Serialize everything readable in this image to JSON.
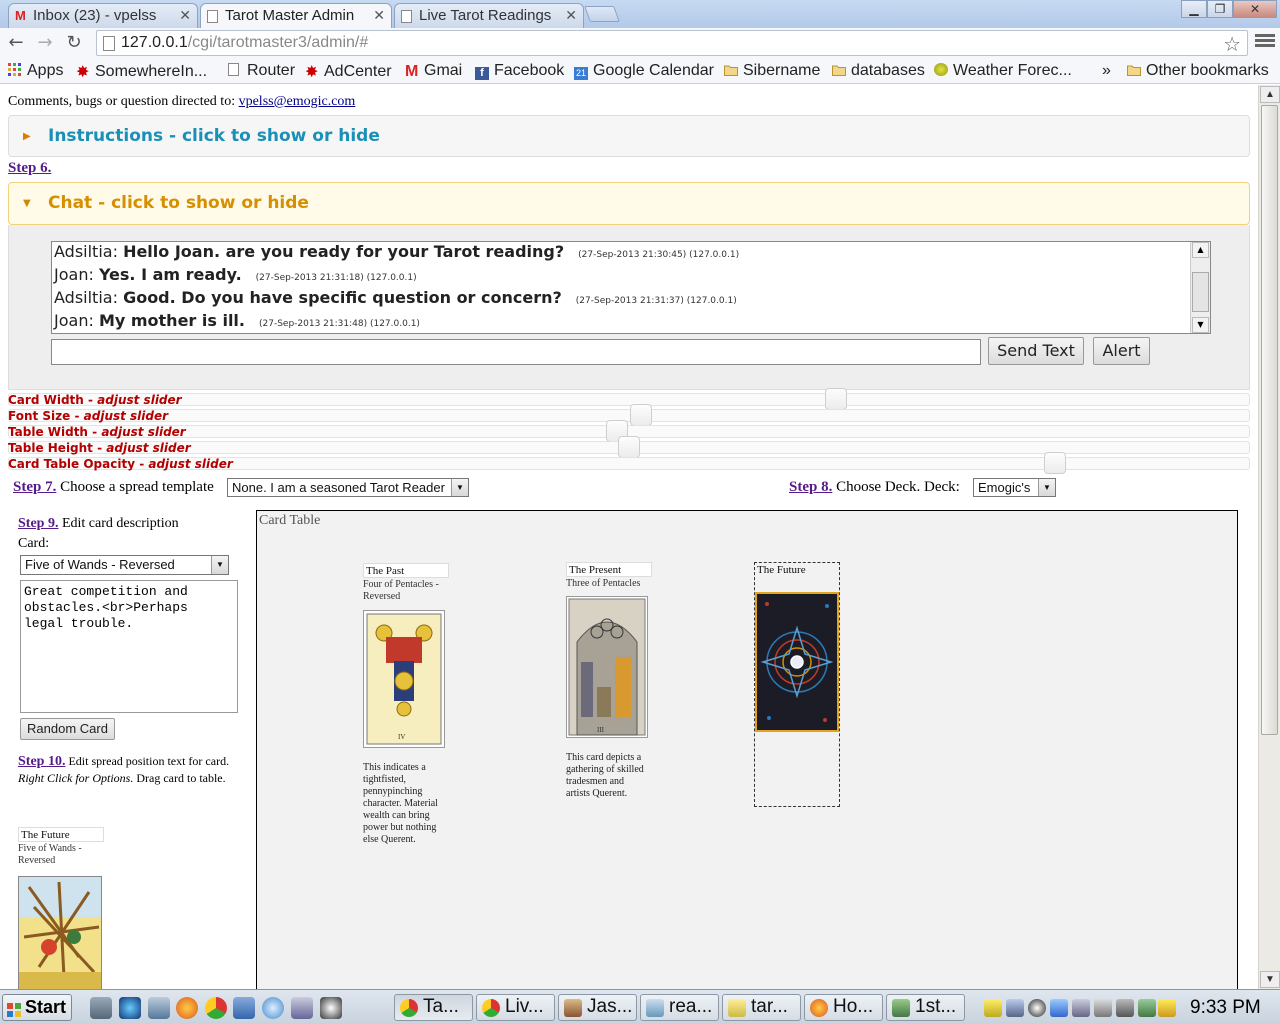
{
  "browser": {
    "tabs": [
      {
        "title": "Inbox (23) - vpelss",
        "icon": "gmail-icon",
        "active": false
      },
      {
        "title": "Tarot Master Admin",
        "icon": "page-icon",
        "active": true
      },
      {
        "title": "Live Tarot Readings",
        "icon": "page-icon",
        "active": false
      }
    ],
    "url_host": "127.0.0.1",
    "url_path": "/cgi/tarotmaster3/admin/#",
    "bookmarks": [
      {
        "label": "Apps",
        "icon": "apps-icon"
      },
      {
        "label": "SomewhereIn...",
        "icon": "maple-leaf-icon"
      },
      {
        "label": "Router",
        "icon": "page-icon"
      },
      {
        "label": "AdCenter",
        "icon": "maple-leaf-icon"
      },
      {
        "label": "Gmai",
        "icon": "gmail-icon"
      },
      {
        "label": "Facebook",
        "icon": "facebook-icon"
      },
      {
        "label": "Google Calendar",
        "icon": "calendar-icon"
      },
      {
        "label": "Sibername",
        "icon": "folder-icon"
      },
      {
        "label": "databases",
        "icon": "folder-icon"
      },
      {
        "label": "Weather Forec...",
        "icon": "weather-icon"
      }
    ],
    "overflow_label": "»",
    "other_bookmarks": "Other bookmarks"
  },
  "page": {
    "contact_prefix": "Comments, bugs or question directed to:",
    "contact_email": "vpelss@emogic.com",
    "instructions_title": "Instructions - click to show or hide",
    "step6": "Step 6.",
    "chat_title": "Chat - click to show or hide",
    "chat_messages": [
      {
        "name": "Adsiltia:",
        "text": "Hello Joan. are you ready for your Tarot reading?",
        "meta": "(27-Sep-2013 21:30:45) (127.0.0.1)"
      },
      {
        "name": "Joan:",
        "text": "Yes. I am ready.",
        "meta": "(27-Sep-2013 21:31:18) (127.0.0.1)"
      },
      {
        "name": "Adsiltia:",
        "text": "Good. Do you have specific question or concern?",
        "meta": "(27-Sep-2013 21:31:37) (127.0.0.1)"
      },
      {
        "name": "Joan:",
        "text": "My mother is ill.",
        "meta": "(27-Sep-2013 21:31:48) (127.0.0.1)"
      }
    ],
    "chat_input_value": "",
    "send_text_label": "Send Text",
    "alert_label": "Alert",
    "sliders": [
      {
        "label": "Card Width - ",
        "hint": "adjust slider",
        "value_pct": 67
      },
      {
        "label": "Font Size - ",
        "hint": "adjust slider",
        "value_pct": 51
      },
      {
        "label": "Table Width - ",
        "hint": "adjust slider",
        "value_pct": 49
      },
      {
        "label": "Table Height - ",
        "hint": "adjust slider",
        "value_pct": 50
      },
      {
        "label": "Card Table Opacity - ",
        "hint": "adjust slider",
        "value_pct": 85
      }
    ],
    "step7": "Step 7.",
    "step7_text": "Choose a spread template",
    "spread_template": "None. I am a seasoned Tarot Reader",
    "step8": "Step 8.",
    "step8_text": "Choose Deck. Deck:",
    "deck": "Emogic's",
    "step9": "Step 9.",
    "step9_text": "Edit card description",
    "card_label": "Card:",
    "card_selected": "Five of Wands - Reversed",
    "card_description": "Great competition and obstacles.<br>Perhaps legal trouble.",
    "random_card_label": "Random Card",
    "step10": "Step 10.",
    "step10_text_a": "Edit spread position text for card.",
    "step10_text_b": "Right Click for Options.",
    "step10_text_c": "Drag card to table.",
    "staging_card": {
      "position": "The Future",
      "name": "Five of Wands - Reversed"
    },
    "card_table_title": "Card Table",
    "table_cards": [
      {
        "position": "The Past",
        "name": "Four of Pentacles - Reversed",
        "description": "This indicates a tightfisted, pennypinching character. Material wealth can bring power but nothing else Querent."
      },
      {
        "position": "The Present",
        "name": "Three of Pentacles",
        "description": "This card depicts a gathering of skilled tradesmen and artists Querent."
      },
      {
        "position": "The Future",
        "name": "",
        "description": ""
      }
    ]
  },
  "taskbar": {
    "start_label": "Start",
    "tasks": [
      {
        "label": "Ta...",
        "icon": "chrome-icon",
        "active": true
      },
      {
        "label": "Liv...",
        "icon": "chrome-icon",
        "active": false
      },
      {
        "label": "Jas...",
        "icon": "app-icon",
        "active": false
      },
      {
        "label": "rea...",
        "icon": "document-icon",
        "active": false
      },
      {
        "label": "tar...",
        "icon": "folder-icon",
        "active": false
      },
      {
        "label": "Ho...",
        "icon": "firefox-icon",
        "active": false
      },
      {
        "label": "1st...",
        "icon": "app-icon",
        "active": false
      }
    ],
    "clock": "9:33 PM"
  },
  "colors": {
    "accent_blue": "#1a8fb7",
    "accent_orange": "#d68f00",
    "slider_label_red": "#b30000",
    "link_purple": "#551a8b"
  }
}
